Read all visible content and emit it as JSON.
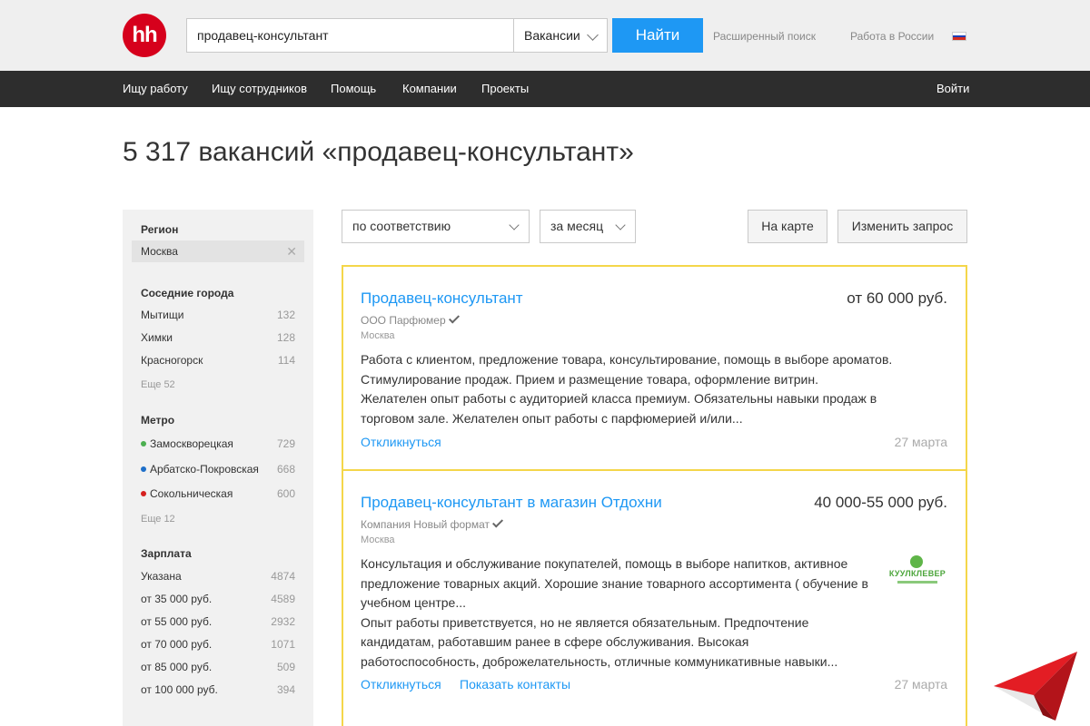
{
  "header": {
    "logo": "hh",
    "search_value": "продавец-консультант",
    "search_type": "Вакансии",
    "find_button": "Найти",
    "advanced_search": "Расширенный поиск",
    "region_link": "Работа в России"
  },
  "nav": {
    "items": [
      "Ищу работу",
      "Ищу сотрудников",
      "Помощь",
      "Компании",
      "Проекты"
    ],
    "login": "Войти"
  },
  "page_title": "5 317 вакансий «продавец-консультант»",
  "sidebar": {
    "region": {
      "heading": "Регион",
      "selected": "Москва"
    },
    "nearby": {
      "heading": "Соседние города",
      "items": [
        {
          "label": "Мытищи",
          "count": "132"
        },
        {
          "label": "Химки",
          "count": "128"
        },
        {
          "label": "Красногорск",
          "count": "114"
        }
      ],
      "more": "Еще 52"
    },
    "metro": {
      "heading": "Метро",
      "items": [
        {
          "label": "Замоскворецкая",
          "count": "729",
          "color": "#4caf50"
        },
        {
          "label": "Арбатско-Покровская",
          "count": "668",
          "color": "#1e6fc9"
        },
        {
          "label": "Сокольническая",
          "count": "600",
          "color": "#d6201f"
        }
      ],
      "more": "Еще 12"
    },
    "salary": {
      "heading": "Зарплата",
      "items": [
        {
          "label": "Указана",
          "count": "4874"
        },
        {
          "label": "от 35 000 руб.",
          "count": "4589"
        },
        {
          "label": "от 55 000 руб.",
          "count": "2932"
        },
        {
          "label": "от 70 000 руб.",
          "count": "1071"
        },
        {
          "label": "от 85 000 руб.",
          "count": "509"
        },
        {
          "label": "от 100 000 руб.",
          "count": "394"
        }
      ]
    }
  },
  "controls": {
    "sort": "по соответствию",
    "period": "за месяц",
    "map_button": "На карте",
    "change_query_button": "Изменить запрос"
  },
  "vacancies": [
    {
      "title": "Продавец-консультант",
      "salary": "от 60 000 руб.",
      "company": "ООО Парфюмер",
      "city": "Москва",
      "desc": [
        "Работа с клиентом, предложение товара, консультирование, помощь в выборе ароматов.",
        "Стимулирование продаж. Прием и размещение товара, оформление витрин.",
        "Желателен опыт работы с аудиторией класса премиум. Обязательны навыки продаж в",
        "торговом зале. Желателен опыт работы с парфюмерией и/или..."
      ],
      "respond": "Откликнуться",
      "date": "27 марта"
    },
    {
      "title": "Продавец-консультант в магазин Отдохни",
      "salary": "40 000-55 000 руб.",
      "company": "Компания Новый формат",
      "city": "Москва",
      "desc": [
        "Консультация и обслуживание покупателей, помощь в выборе напитков, активное",
        "предложение товарных акций. Хорошие знание товарного ассортимента ( обучение в",
        "учебном центре...",
        "Опыт работы приветствуется, но не является обязательным. Предпочтение",
        "кандидатам, работавшим ранее в сфере обслуживания. Высокая",
        "работоспособность, доброжелательность, отличные коммуникативные навыки..."
      ],
      "respond": "Откликнуться",
      "show_contacts": "Показать контакты",
      "date": "27 марта",
      "employer_logo": "КУУЛКЛЕВЕР"
    }
  ],
  "colors": {
    "accent_blue": "#1e98f4",
    "logo_red": "#d6001c",
    "card_border": "#f4d64a",
    "nav_dark": "#2d2d2d"
  }
}
